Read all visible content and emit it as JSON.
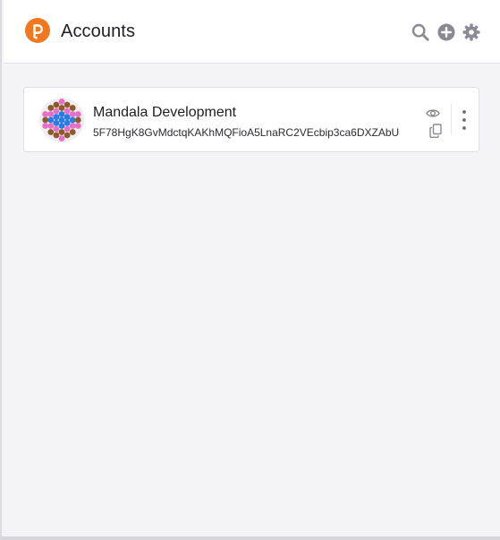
{
  "header": {
    "title": "Accounts",
    "logo_icon": "polkadot-logo-icon",
    "actions": [
      {
        "icon": "search-icon"
      },
      {
        "icon": "add-circle-icon"
      },
      {
        "icon": "gear-icon"
      }
    ]
  },
  "accounts": [
    {
      "name": "Mandala Development",
      "address": "5F78HgK8GvMdctqKAKhMQFioA5LnaRC2VEcbip3ca6DXZAbU",
      "actions": {
        "visibility_icon": "eye-icon",
        "copy_icon": "copy-icon",
        "menu_icon": "more-vertical-icon"
      }
    }
  ],
  "colors": {
    "brand": "#f0781e",
    "icon": "#8a8a93",
    "background": "#f4f4f7",
    "card": "#ffffff"
  }
}
